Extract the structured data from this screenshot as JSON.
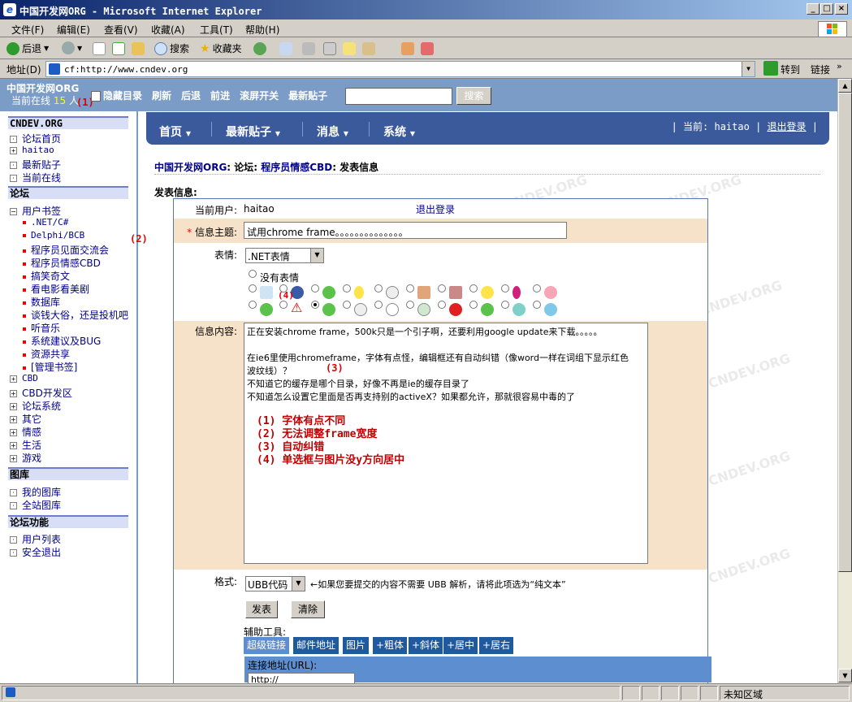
{
  "window": {
    "title": "中国开发网ORG - Microsoft Internet Explorer",
    "controls": [
      "_",
      "□",
      "×"
    ]
  },
  "menu": [
    "文件(F)",
    "编辑(E)",
    "查看(V)",
    "收藏(A)",
    "工具(T)",
    "帮助(H)"
  ],
  "toolbar": {
    "back": "后退",
    "search": "搜索",
    "favorites": "收藏夹"
  },
  "address": {
    "label": "地址(D)",
    "url": "cf:http://www.cndev.org",
    "go": "转到",
    "links": "链接"
  },
  "page_top": {
    "site": "中国开发网ORG",
    "online_prefix": "当前在线",
    "online_count": "15",
    "online_suffix": "人",
    "links": [
      "隐藏目录",
      "刷新",
      "后退",
      "前进",
      "滚屏开关",
      "最新贴子"
    ],
    "search_button": "搜索",
    "annotation1": "(1)"
  },
  "sidebar": {
    "head1": "CNDEV.ORG",
    "items1": [
      "论坛首页",
      "haitao",
      "最新贴子",
      "当前在线"
    ],
    "head2": "论坛",
    "bookmarks": "用户书签",
    "sub": [
      ".NET/C#",
      "Delphi/BCB",
      "程序员见面交流会",
      "程序员情感CBD",
      "搞笑奇文",
      "看电影看美剧",
      "数据库",
      "谈钱大俗，还是投机吧",
      "听音乐",
      "系统建议及BUG",
      "资源共享",
      "[管理书签]"
    ],
    "items2": [
      "CBD",
      "CBD开发区",
      "论坛系统",
      "其它",
      "情感",
      "生活",
      "游戏"
    ],
    "head3": "图库",
    "items3": [
      "我的图库",
      "全站图库"
    ],
    "head4": "论坛功能",
    "items4": [
      "用户列表",
      "安全退出"
    ],
    "annotation2": "(2)"
  },
  "mainnav": {
    "items": [
      "首页",
      "最新贴子",
      "消息",
      "系统"
    ],
    "current_label": "当前: haitao",
    "logout": "退出登录"
  },
  "breadcrumb": {
    "site": "中国开发网ORG",
    "sep1": ": 论坛: ",
    "board": "程序员情感CBD",
    "tail": ": 发表信息"
  },
  "post_label": "发表信息:",
  "form": {
    "user_label": "当前用户:",
    "user": "haitao",
    "logout": "退出登录",
    "subject_label": "信息主题:",
    "subject": "试用chrome frame。。。。。。。。。。。。。。",
    "emotion_label": "表情:",
    "emotion_select": ".NET表情",
    "no_emotion": "没有表情",
    "annotation4": "(4)",
    "content_label": "信息内容:",
    "content_lines": [
      "正在安装chrome frame，500k只是一个引子啊，还要利用google update来下载。。。。。",
      "",
      "在ie6里使用chromeframe，字体有点怪，编辑框还有自动纠错（像word一样在词组下显示红色",
      "波纹线）？",
      "不知道它的缓存是哪个目录，好像不再是ie的缓存目录了",
      "不知道怎么设置它里面是否再支持别的activeX？如果都允许，那就很容易中毒的了"
    ],
    "annotation3": "(3)",
    "red_lines": [
      "(1) 字体有点不同",
      "(2) 无法调整frame宽度",
      "(3) 自动纠错",
      "(4) 单选框与图片没y方向居中"
    ],
    "format_label": "格式:",
    "format_select": "UBB代码",
    "format_hint": "←如果您要提交的内容不需要 UBB 解析，请将此项选为“纯文本”",
    "submit": "发表",
    "clear": "清除",
    "aux_label": "辅助工具:",
    "tools": [
      "超级链接",
      "邮件地址",
      "图片",
      "+粗体",
      "+斜体",
      "+居中",
      "+居右"
    ],
    "url_label": "连接地址(URL):",
    "url_value": "http://"
  },
  "status": {
    "zone": "未知区域"
  },
  "watermark": "CNDEV.ORG"
}
